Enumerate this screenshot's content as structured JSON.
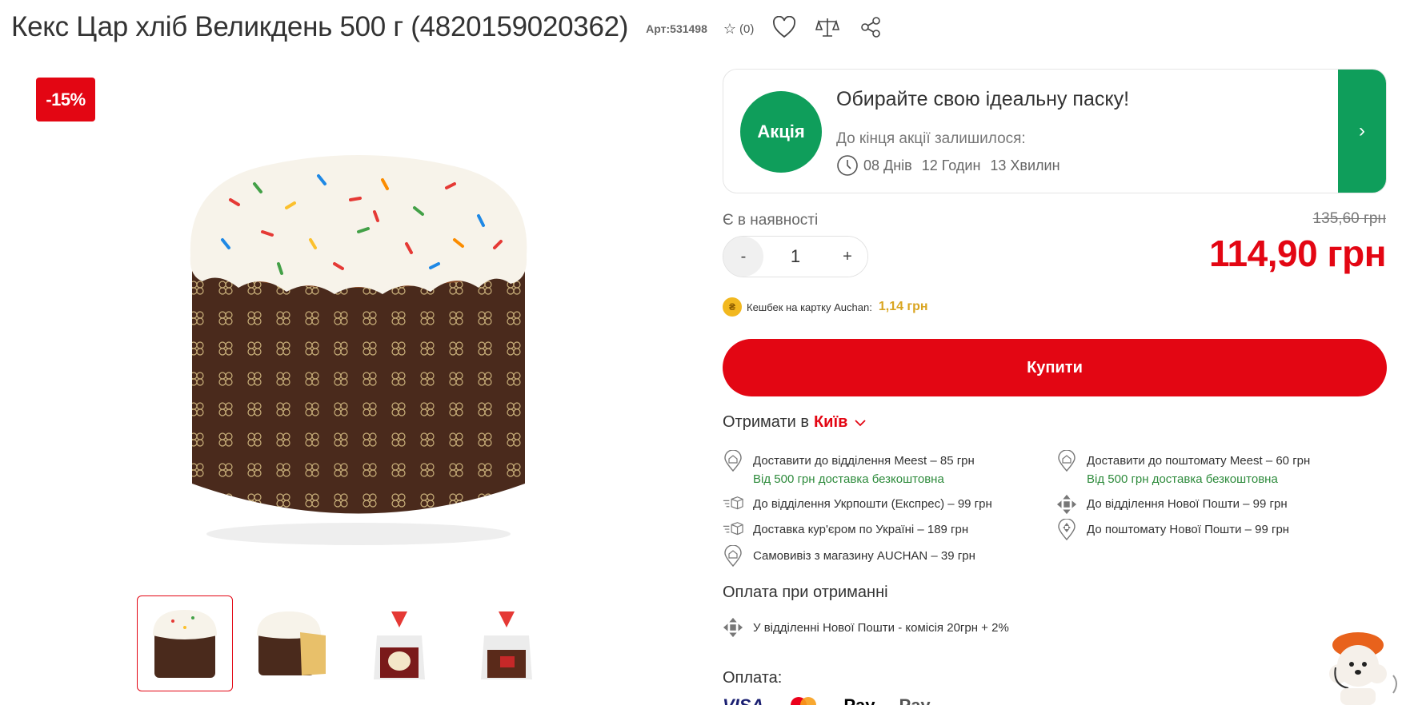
{
  "product": {
    "title": "Кекс Цар хліб Великдень 500 г (4820159020362)",
    "sku": "Арт:531498",
    "rating_count": "(0)",
    "discount_badge": "-15%"
  },
  "promo": {
    "badge": "Акція",
    "title": "Обирайте свою ідеальну паску!",
    "subtitle": "До кінця акції залишилося:",
    "days": "08 Днів",
    "hours": "12 Годин",
    "minutes": "13 Хвилин",
    "arrow": "›"
  },
  "stock": "Є в наявності",
  "price": {
    "old": "135,60 грн",
    "current": "114,90 грн"
  },
  "quantity": {
    "minus": "-",
    "value": "1",
    "plus": "+"
  },
  "cashback": {
    "label": "Кешбек на картку Auchan:",
    "value": "1,14 грн"
  },
  "buy_label": "Купити",
  "receive": {
    "label": "Отримати в",
    "city": "Київ"
  },
  "deliveries": [
    {
      "text": "Доставити до відділення Meest – 85 грн",
      "note": "Від 500 грн доставка безкоштовна",
      "icon": "map-pin-home-icon"
    },
    {
      "text": "Доставити до поштомату Meest – 60 грн",
      "note": "Від 500 грн доставка безкоштовна",
      "icon": "map-pin-home-icon"
    },
    {
      "text": "До відділення Укрпошти (Експрес) – 99 грн",
      "note": "",
      "icon": "fast-box-icon"
    },
    {
      "text": "До відділення Нової Пошти – 99 грн",
      "note": "",
      "icon": "nova-poshta-icon"
    },
    {
      "text": "Доставка кур'єром по Україні – 189 грн",
      "note": "",
      "icon": "fast-box-icon"
    },
    {
      "text": "До поштомату Нової Пошти – 99 грн",
      "note": "",
      "icon": "nova-pin-icon"
    },
    {
      "text": "Самовивіз з магазину AUCHAN – 39 грн",
      "note": "",
      "icon": "map-pin-home-icon"
    }
  ],
  "pay_on_receive": {
    "title": "Оплата при отриманні",
    "row": "У відділенні Нової Пошти - комісія 20грн + 2%"
  },
  "payment": {
    "title": "Оплата:",
    "logos": [
      "VISA",
      "",
      "Pay",
      "Pay"
    ]
  },
  "colors": {
    "brand_red": "#e30613",
    "promo_green": "#0f9e5b",
    "cashback_gold": "#d9a521",
    "free_green": "#2e8b3c"
  }
}
